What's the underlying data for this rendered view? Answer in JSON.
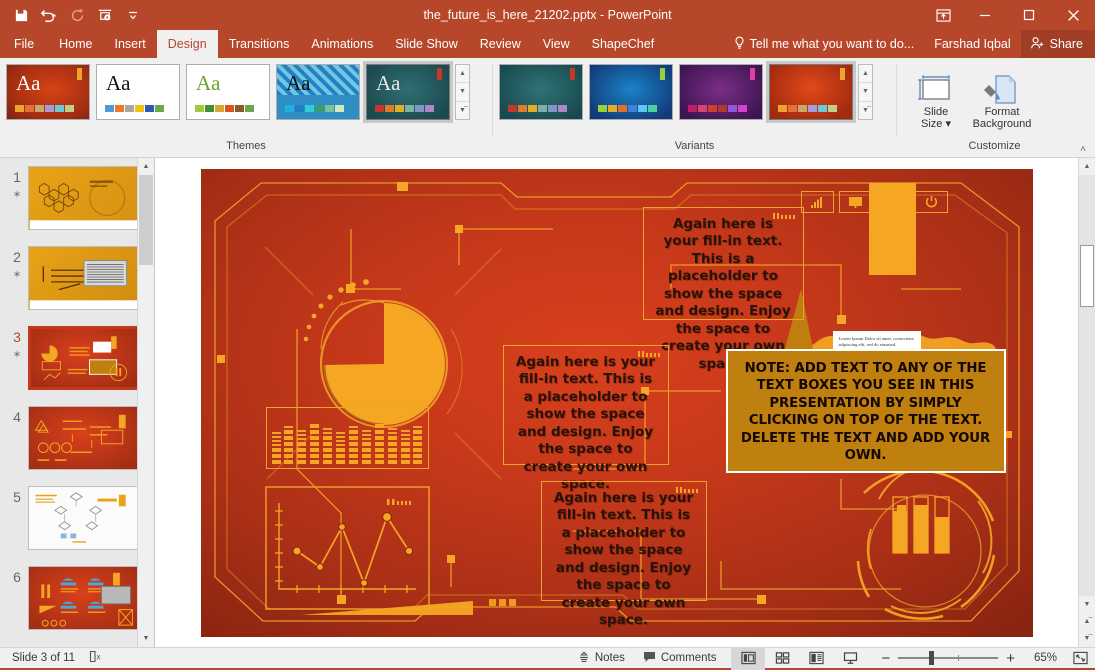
{
  "titlebar": {
    "document_title": "the_future_is_here_21202.pptx - PowerPoint",
    "qat": [
      {
        "name": "save-icon",
        "label": "Save"
      },
      {
        "name": "undo-icon",
        "label": "Undo"
      },
      {
        "name": "redo-icon",
        "label": "Redo"
      },
      {
        "name": "start-presentation-icon",
        "label": "Start From Beginning"
      },
      {
        "name": "customize-qat-icon",
        "label": "Customize Quick Access Toolbar"
      }
    ],
    "window_controls": [
      {
        "name": "ribbon-display-options-icon",
        "label": "Ribbon Display Options"
      },
      {
        "name": "minimize-icon",
        "label": "Minimize"
      },
      {
        "name": "maximize-icon",
        "label": "Maximize"
      },
      {
        "name": "close-icon",
        "label": "Close"
      }
    ]
  },
  "tabs": {
    "items": [
      {
        "label": "File",
        "active": false
      },
      {
        "label": "Home",
        "active": false
      },
      {
        "label": "Insert",
        "active": false
      },
      {
        "label": "Design",
        "active": true
      },
      {
        "label": "Transitions",
        "active": false
      },
      {
        "label": "Animations",
        "active": false
      },
      {
        "label": "Slide Show",
        "active": false
      },
      {
        "label": "Review",
        "active": false
      },
      {
        "label": "View",
        "active": false
      },
      {
        "label": "ShapeChef",
        "active": false
      }
    ],
    "tell_me": "Tell me what you want to do...",
    "user_name": "Farshad Iqbal",
    "share_label": "Share"
  },
  "ribbon": {
    "themes_group_label": "Themes",
    "variants_group_label": "Variants",
    "customize_group_label": "Customize",
    "themes": [
      {
        "name": "theme-office-red",
        "aa": "Aa",
        "aa_color": "#ffffff",
        "bg": "radial-gradient(ellipse at 55% 45%, #d84315 0%, #9c2b12 75%, #7a2110 100%)",
        "tag": "#f0a32a",
        "swatches": [
          "#f0a32a",
          "#e2703a",
          "#c8a96b",
          "#a99bd6",
          "#6ec8da",
          "#bcd08a"
        ]
      },
      {
        "name": "theme-office-white",
        "aa": "Aa",
        "aa_color": "#111111",
        "bg": "#ffffff",
        "tag": "",
        "swatches": [
          "#4e9ad4",
          "#e8792b",
          "#a6a6a6",
          "#f4c20d",
          "#2a5db0",
          "#6aa84f"
        ]
      },
      {
        "name": "theme-facet-green",
        "aa": "Aa",
        "aa_color": "#6aa22e",
        "bg": "#ffffff",
        "tag": "",
        "swatches": [
          "#9fcb3b",
          "#3f8f36",
          "#d9a62e",
          "#d9541e",
          "#8a5a2b",
          "#6aa84f"
        ]
      },
      {
        "name": "theme-berlin-blue",
        "aa": "Aa",
        "aa_color": "#111111",
        "bg": "#2f8fc4",
        "tag": "",
        "swatches": [
          "#22b0e0",
          "#1f7fc4",
          "#2ecfd8",
          "#3a9b6e",
          "#7ac29a",
          "#cfe8c0"
        ]
      },
      {
        "name": "theme-ion-teal",
        "aa": "Aa",
        "aa_color": "#e8e8e8",
        "bg": "radial-gradient(ellipse at 50% 45%, #2f6f72 0%, #1c4a50 80%)",
        "tag": "#c0392b",
        "swatches": [
          "#c0392b",
          "#e07b2c",
          "#e0b02c",
          "#7fb0a8",
          "#8096c4",
          "#b086c8"
        ]
      }
    ],
    "variants": [
      {
        "name": "variant-teal",
        "bg": "radial-gradient(ellipse at 50% 45%, #2f7374 0%, #18494f 85%)",
        "tag": "#c0392b",
        "swatches": [
          "#c0392b",
          "#e07b2c",
          "#e0b02c",
          "#7fb0a8",
          "#8096c4",
          "#b086c8"
        ]
      },
      {
        "name": "variant-blue",
        "bg": "radial-gradient(ellipse at 50% 45%, #1a83c8 0%, #123a78 85%)",
        "tag": "#9ad13a",
        "swatches": [
          "#9ad13a",
          "#e0b02c",
          "#e0702c",
          "#3f80d8",
          "#5fc8ef",
          "#4fd0a0"
        ]
      },
      {
        "name": "variant-purple",
        "bg": "radial-gradient(ellipse at 50% 45%, #7b2d86 0%, #3d1550 85%)",
        "tag": "#e040a0",
        "swatches": [
          "#c01f66",
          "#d8436f",
          "#c8432e",
          "#b03a2e",
          "#8a5ad8",
          "#d940c8"
        ]
      },
      {
        "name": "variant-orange-red",
        "bg": "radial-gradient(ellipse at 50% 42%, #e24a18 0%, #a32a10 80%)",
        "tag": "#f0a32a",
        "swatches": [
          "#f0a32a",
          "#e2703a",
          "#c8a96b",
          "#a99bd6",
          "#6ec8da",
          "#bcd08a"
        ]
      }
    ],
    "customize_buttons": [
      {
        "name": "slide-size-button",
        "line1": "Slide",
        "line2": "Size ▾"
      },
      {
        "name": "format-background-button",
        "line1": "Format",
        "line2": "Background"
      }
    ],
    "collapse_label": "˄"
  },
  "slide_panel": {
    "slides": [
      {
        "number": "1",
        "star": "✶",
        "selected": false
      },
      {
        "number": "2",
        "star": "✶",
        "selected": false
      },
      {
        "number": "3",
        "star": "✶",
        "selected": true
      },
      {
        "number": "4",
        "star": "",
        "selected": false
      },
      {
        "number": "5",
        "star": "",
        "selected": false
      },
      {
        "number": "6",
        "star": "",
        "selected": false
      }
    ]
  },
  "slide": {
    "textbox_1": "Again here is your fill-in text. This is a placeholder to show the space and design. Enjoy the space to create your own space.",
    "textbox_2": "Again here is your fill-in text. This is a placeholder to show the space and design. Enjoy the space to create your own space.",
    "textbox_3": "Again here is your fill-in text. This is a placeholder to show the space and design. Enjoy the space to create your own space.",
    "note_callout": "NOTE: ADD TEXT TO ANY OF THE TEXT BOXES YOU SEE IN THIS PRESENTATION BY SIMPLY CLICKING ON TOP OF THE TEXT. DELETE THE TEXT AND ADD YOUR OWN.",
    "lorem_card": "Lorem Ipsum Dolor sit amet, consectetur adipiscing elit, sed do eiusmod.",
    "hud_icons": [
      {
        "name": "bar-chart-icon"
      },
      {
        "name": "book-icon"
      },
      {
        "name": "gear-icon"
      },
      {
        "name": "power-icon"
      }
    ],
    "accent_color": "#f5a623",
    "outline_color": "#f0a32a"
  },
  "statusbar": {
    "slide_indicator": "Slide 3 of 11",
    "language_icon": "spell-check-icon",
    "notes_label": "Notes",
    "comments_label": "Comments",
    "views": [
      {
        "name": "normal-view-button",
        "active": true
      },
      {
        "name": "slide-sorter-view-button",
        "active": false
      },
      {
        "name": "reading-view-button",
        "active": false
      },
      {
        "name": "slide-show-view-button",
        "active": false
      }
    ],
    "zoom_out_label": "−",
    "zoom_in_label": "+",
    "zoom_percent": "65%",
    "fit_label": "fit-slide-to-window-icon"
  }
}
